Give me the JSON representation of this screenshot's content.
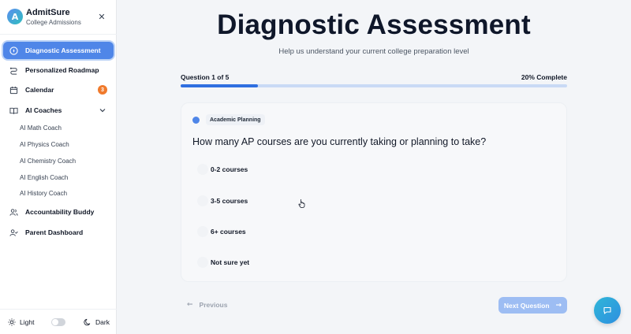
{
  "brand": {
    "name": "AdmitSure",
    "subtitle": "College Admissions",
    "logo_letter": "A"
  },
  "sidebar": {
    "items": [
      {
        "label": "Diagnostic Assessment",
        "icon": "compass-icon",
        "active": true
      },
      {
        "label": "Personalized Roadmap",
        "icon": "route-icon"
      },
      {
        "label": "Calendar",
        "icon": "calendar-icon",
        "badge": "3"
      },
      {
        "label": "AI Coaches",
        "icon": "book-icon",
        "expanded": true
      },
      {
        "label": "Accountability Buddy",
        "icon": "users-icon"
      },
      {
        "label": "Parent Dashboard",
        "icon": "user-check-icon"
      }
    ],
    "coaches": [
      "AI Math Coach",
      "AI Physics Coach",
      "AI Chemistry Coach",
      "AI English Coach",
      "AI History Coach"
    ],
    "theme": {
      "light": "Light",
      "dark": "Dark"
    }
  },
  "main": {
    "title": "Diagnostic Assessment",
    "subtitle": "Help us understand your current college preparation level",
    "progress": {
      "label": "Question 1 of 5",
      "percent_label": "20% Complete",
      "value": 0.2
    },
    "question": {
      "category": "Academic Planning",
      "text": "How many AP courses are you currently taking or planning to take?",
      "options": [
        "0-2 courses",
        "3-5 courses",
        "6+ courses",
        "Not sure yet"
      ]
    },
    "prev_label": "Previous",
    "next_label": "Next Question"
  },
  "colors": {
    "accent": "#4f86e8",
    "badge": "#f07a2c",
    "progress": "#2f6fe0"
  }
}
